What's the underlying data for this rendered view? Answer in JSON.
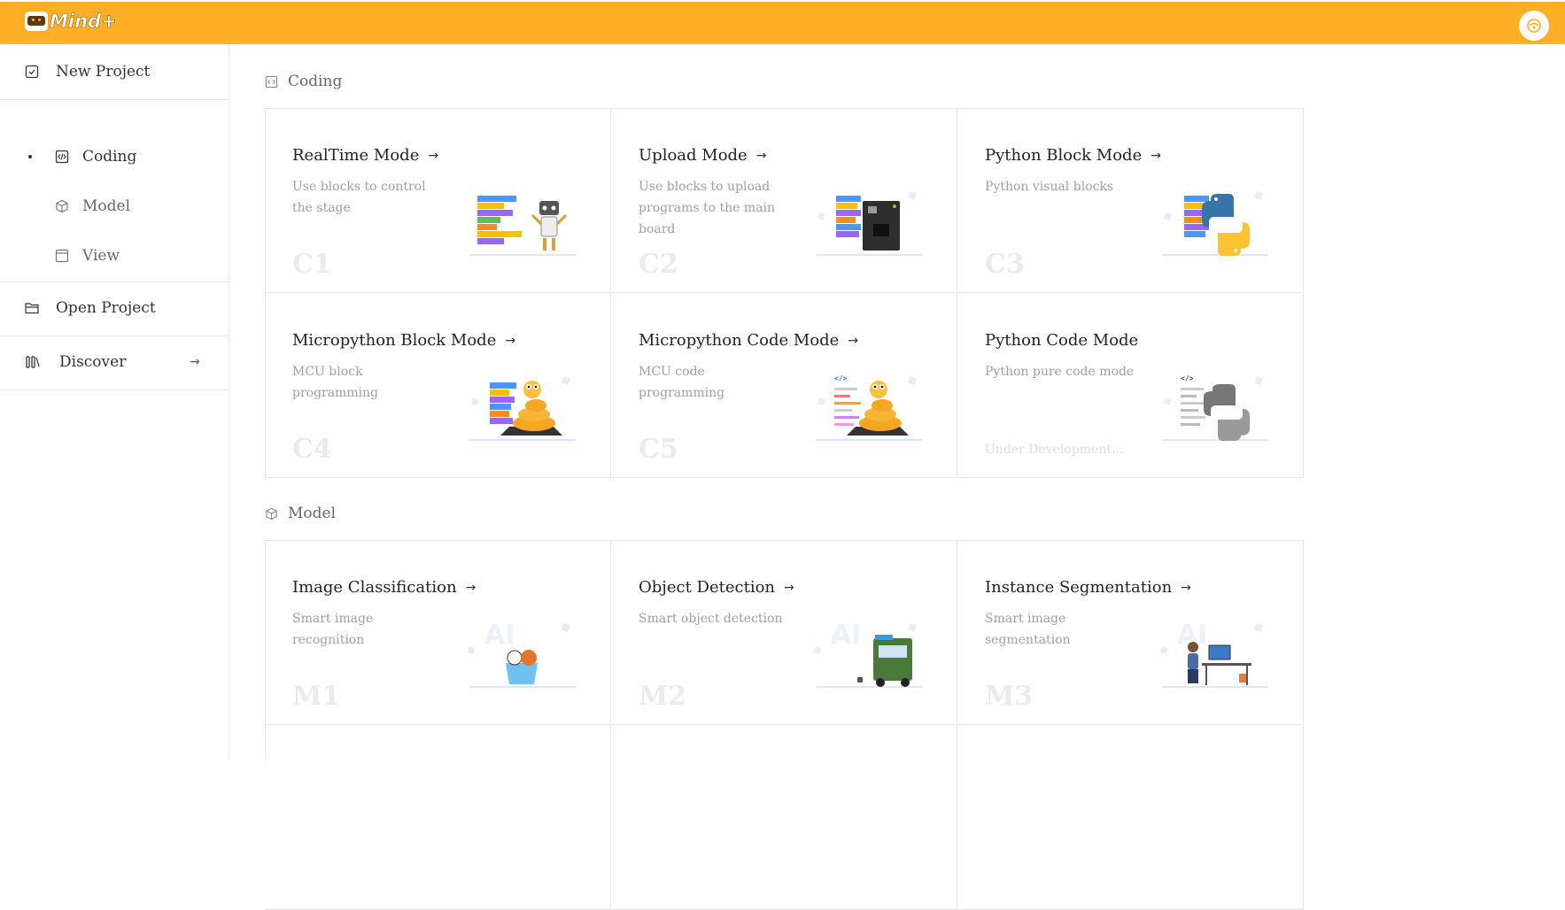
{
  "app": {
    "title": "Mind+"
  },
  "sidebar": {
    "new_project": "New Project",
    "coding": "Coding",
    "model": "Model",
    "view": "View",
    "open_project": "Open Project",
    "discover": "Discover"
  },
  "sections": {
    "coding": "Coding",
    "model": "Model"
  },
  "coding_cards": [
    {
      "title": "RealTime Mode",
      "arrow": "→",
      "desc": "Use blocks to control the stage",
      "code": "C1"
    },
    {
      "title": "Upload Mode",
      "arrow": "→",
      "desc": "Use blocks to upload programs to the main board",
      "code": "C2"
    },
    {
      "title": "Python Block Mode",
      "arrow": "→",
      "desc": "Python visual blocks",
      "code": "C3"
    },
    {
      "title": "Micropython Block Mode",
      "arrow": "→",
      "desc": "MCU block programming",
      "code": "C4"
    },
    {
      "title": "Micropython Code Mode",
      "arrow": "→",
      "desc": "MCU code programming",
      "code": "C5"
    },
    {
      "title": "Python Code Mode",
      "desc": "Python pure code mode",
      "note": "Under Development..."
    }
  ],
  "model_cards": [
    {
      "title": "Image Classification",
      "arrow": "→",
      "desc": "Smart image recognition",
      "code": "M1"
    },
    {
      "title": "Object Detection",
      "arrow": "→",
      "desc": "Smart object detection",
      "code": "M2"
    },
    {
      "title": "Instance Segmentation",
      "arrow": "→",
      "desc": "Smart image segmentation",
      "code": "M3"
    }
  ],
  "colors": {
    "brand": "#FFAF26",
    "code_watermark": "#EBEBEB"
  }
}
